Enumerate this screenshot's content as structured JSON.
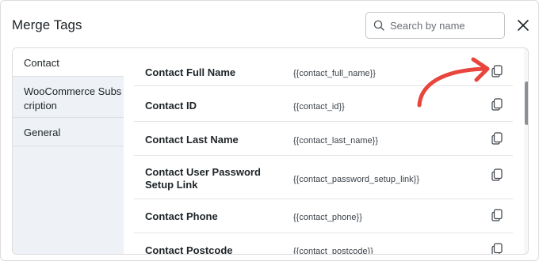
{
  "modal": {
    "title": "Merge Tags",
    "search_placeholder": "Search by name",
    "search_value": ""
  },
  "sidebar": {
    "items": [
      {
        "label": "Contact"
      },
      {
        "label": "WooCommerce Subscription"
      },
      {
        "label": "General"
      }
    ]
  },
  "tags": [
    {
      "name": "Contact Full Name",
      "tag": "{{contact_full_name}}"
    },
    {
      "name": "Contact ID",
      "tag": "{{contact_id}}"
    },
    {
      "name": "Contact Last Name",
      "tag": "{{contact_last_name}}"
    },
    {
      "name": "Contact User Password Setup Link",
      "tag": "{{contact_password_setup_link}}"
    },
    {
      "name": "Contact Phone",
      "tag": "{{contact_phone}}"
    },
    {
      "name": "Contact Postcode",
      "tag": "{{contact_postcode}}"
    }
  ],
  "colors": {
    "annotation_arrow": "#e8453c",
    "sidebar_bg": "#eef2f6"
  },
  "icons": {
    "search": "search-icon",
    "close": "close-icon",
    "copy": "copy-icon"
  }
}
